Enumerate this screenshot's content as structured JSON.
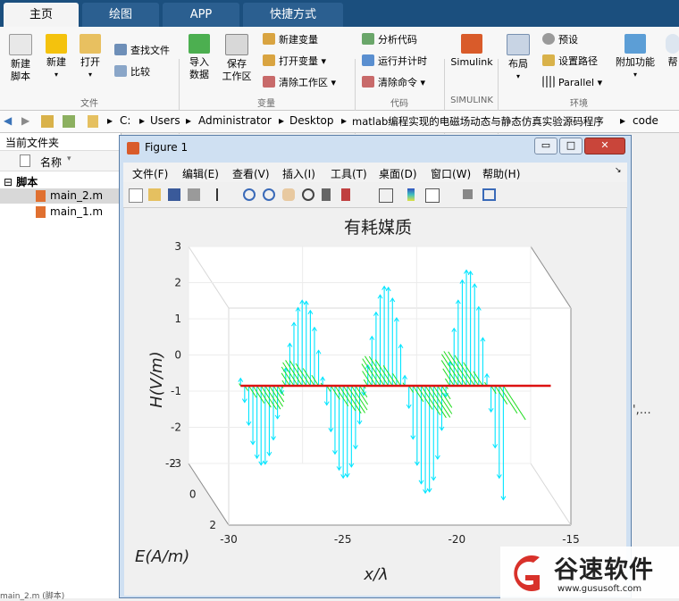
{
  "tabs": [
    "主页",
    "绘图",
    "APP",
    "快捷方式"
  ],
  "ribbon": {
    "new_script": "新建\n脚本",
    "new": "新建",
    "open": "打开",
    "find_files": "查找文件",
    "compare": "比较",
    "import": "导入\n数据",
    "save_ws": "保存\n工作区",
    "new_var": "新建变量",
    "open_var": "打开变量",
    "clear_ws": "清除工作区",
    "analyze": "分析代码",
    "run_time": "运行并计时",
    "clear_cmd": "清除命令",
    "simulink": "Simulink",
    "layout": "布局",
    "prefs": "预设",
    "set_path": "设置路径",
    "parallel": "Parallel",
    "addons": "附加功能",
    "help_cut": "帮",
    "groups": [
      "文件",
      "变量",
      "代码",
      "SIMULINK",
      "环境"
    ]
  },
  "address": {
    "path": [
      "C:",
      "Users",
      "Administrator",
      "Desktop",
      "matlab编程实现的电磁场动态与静态仿真实验源码程序",
      "code"
    ]
  },
  "left_panel": {
    "title": "当前文件夹",
    "col_name": "名称",
    "folder": "脚本",
    "files": [
      "main_2.m",
      "main_1.m"
    ],
    "bottom_text": "main_2.m  (脚本)"
  },
  "figure": {
    "title": "Figure 1",
    "menus": [
      "文件(F)",
      "编辑(E)",
      "查看(V)",
      "插入(I)",
      "工具(T)",
      "桌面(D)",
      "窗口(W)",
      "帮助(H)"
    ],
    "plot_title": "有耗媒质",
    "zlabel": "H(V/m)",
    "ylabel": "E(A/m)",
    "xlabel": "x/λ",
    "z_ticks": [
      "3",
      "2",
      "1",
      "0",
      "-1",
      "-2",
      "-3"
    ],
    "y_ticks": [
      "2",
      "0",
      "-2"
    ],
    "x_ticks": [
      "-30",
      "-25",
      "-20",
      "-15"
    ]
  },
  "right_status": "',…",
  "watermark": {
    "brand": "谷速软件",
    "url": "www.gususoft.com"
  },
  "colors": {
    "tab_bar": "#1b4f7e",
    "h_field": "#00e5ff",
    "e_field": "#22dd22",
    "axis_line": "#dd1111"
  },
  "chart_data": {
    "type": "quiver3d",
    "title": "有耗媒质",
    "xlabel": "x/λ",
    "ylabel": "E(A/m)",
    "zlabel": "H(V/m)",
    "xlim": [
      -30,
      -15
    ],
    "ylim": [
      -2,
      2
    ],
    "zlim": [
      -3,
      3
    ],
    "x_ticks": [
      -30,
      -25,
      -20,
      -15
    ],
    "y_ticks": [
      -2,
      0,
      2
    ],
    "z_ticks": [
      3,
      2,
      1,
      0,
      -1,
      -2,
      -3
    ],
    "series": [
      {
        "name": "H",
        "color": "#00e5ff"
      },
      {
        "name": "E",
        "color": "#22dd22"
      },
      {
        "name": "axis",
        "color": "#dd1111"
      }
    ]
  }
}
